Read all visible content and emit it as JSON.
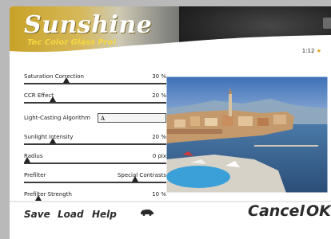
{
  "header": {
    "title": "Sunshine",
    "subtitle": "Tec Color Glass Pro!",
    "page_counter": "1:12",
    "star": "★"
  },
  "controls": [
    {
      "label": "Saturation Correction",
      "value": "30 %",
      "level": 0.3
    },
    {
      "label": "CCR Effect",
      "value": "20 %",
      "level": 0.2
    },
    {
      "label": "Light-Casting Algorithm",
      "value": "A"
    },
    {
      "label": "Sunlight Intensity",
      "value": "20 %",
      "level": 0.2
    },
    {
      "label": "Radius",
      "value": "0 pix",
      "level": 0.0
    },
    {
      "label": "Prefilter",
      "value": "Special Contrasts",
      "level": 0.78
    },
    {
      "label": "Prefilter Strength",
      "value": "10 %",
      "level": 0.1
    }
  ],
  "footer": {
    "save": "Save",
    "load": "Load",
    "help": "Help",
    "cancel": "Cancel",
    "ok": "OK"
  },
  "colors": {
    "accent_yellow": "#f4d642",
    "text_dark": "#2a2a2a"
  },
  "icons": [
    "car-icon"
  ]
}
